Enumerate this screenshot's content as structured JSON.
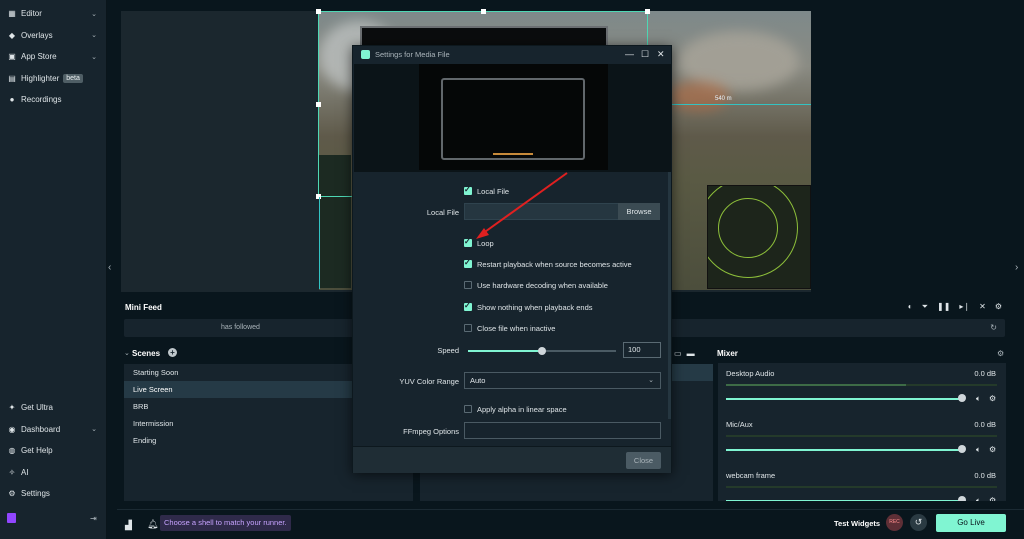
{
  "sidebar": {
    "items": [
      {
        "label": "Editor",
        "icon": "editor-icon"
      },
      {
        "label": "Overlays",
        "icon": "overlays-icon"
      },
      {
        "label": "App Store",
        "icon": "app-store-icon"
      },
      {
        "label": "Highlighter",
        "icon": "highlighter-icon",
        "badge": "beta"
      },
      {
        "label": "Recordings",
        "icon": "recordings-icon"
      }
    ],
    "bottom_items": [
      {
        "label": "Get Ultra",
        "icon": "ultra-icon"
      },
      {
        "label": "Dashboard",
        "icon": "dashboard-icon"
      },
      {
        "label": "Get Help",
        "icon": "help-icon"
      },
      {
        "label": "AI",
        "icon": "ai-icon"
      },
      {
        "label": "Settings",
        "icon": "gear-icon"
      }
    ]
  },
  "preview": {
    "range_readout": "540 m"
  },
  "mini_feed": {
    "title": "Mini Feed",
    "event_text": "has followed"
  },
  "scenes": {
    "title": "Scenes",
    "items": [
      "Starting Soon",
      "Live Screen",
      "BRB",
      "Intermission",
      "Ending"
    ],
    "active_index": 1
  },
  "mixer": {
    "title": "Mixer",
    "channels": [
      {
        "name": "Desktop Audio",
        "db": "0.0 dB"
      },
      {
        "name": "Mic/Aux",
        "db": "0.0 dB"
      },
      {
        "name": "webcam frame",
        "db": "0.0 dB"
      }
    ]
  },
  "bottom_bar": {
    "tip": "Choose a shell to match your runner.",
    "test_widgets": "Test Widgets",
    "rec_label": "REC",
    "go_live": "Go Live"
  },
  "modal": {
    "title": "Settings for Media File",
    "local_file_checkbox": {
      "label": "Local File",
      "checked": true
    },
    "local_file_label": "Local File",
    "local_file_value": "",
    "browse_label": "Browse",
    "checkboxes": [
      {
        "label": "Loop",
        "checked": true
      },
      {
        "label": "Restart playback when source becomes active",
        "checked": true
      },
      {
        "label": "Use hardware decoding when available",
        "checked": false
      },
      {
        "label": "Show nothing when playback ends",
        "checked": true
      },
      {
        "label": "Close file when inactive",
        "checked": false
      }
    ],
    "speed_label": "Speed",
    "speed_value": "100",
    "speed_fraction": 0.5,
    "yuv_label": "YUV Color Range",
    "yuv_value": "Auto",
    "alpha_label": "Apply alpha in linear space",
    "alpha_checked": false,
    "ffmpeg_label": "FFmpeg Options",
    "ffmpeg_value": "",
    "close_label": "Close"
  },
  "colors": {
    "accent": "#80f5d2",
    "panel": "#17242d",
    "background": "#09161d",
    "annotation_arrow": "#e02020"
  }
}
